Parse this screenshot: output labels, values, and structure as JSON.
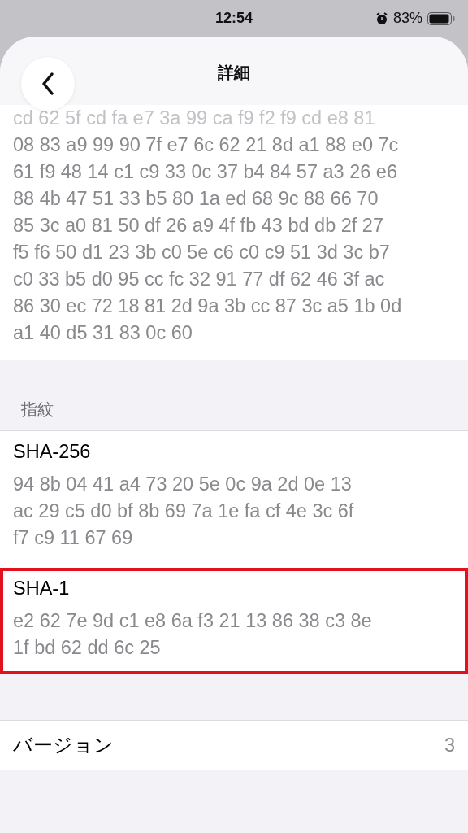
{
  "status_bar": {
    "time": "12:54",
    "battery": "83%"
  },
  "nav": {
    "title": "詳細"
  },
  "key_block": {
    "lines": [
      {
        "text": "cd 62 5f cd fa e7 3a 99 ca f9 f2 f9 cd e8 81",
        "faded": true
      },
      {
        "text": "08 83 a9 99 90 7f e7 6c 62 21 8d a1 88 e0 7c",
        "faded": false
      },
      {
        "text": "61 f9 48 14 c1 c9 33 0c 37 b4 84 57 a3 26 e6",
        "faded": false
      },
      {
        "text": "88 4b 47 51 33 b5 80 1a ed 68 9c 88 66 70",
        "faded": false
      },
      {
        "text": "85 3c a0 81 50 df 26 a9 4f fb 43 bd db 2f 27",
        "faded": false
      },
      {
        "text": "f5 f6 50 d1 23 3b c0 5e c6 c0 c9 51 3d 3c b7",
        "faded": false
      },
      {
        "text": "c0 33 b5 d0 95 cc fc 32 91 77 df 62 46 3f ac",
        "faded": false
      },
      {
        "text": "86 30 ec 72 18 81 2d 9a 3b cc 87 3c a5 1b 0d",
        "faded": false
      },
      {
        "text": "a1 40 d5 31 83 0c 60",
        "faded": false
      }
    ]
  },
  "fingerprints": {
    "header": "指紋",
    "items": [
      {
        "label": "SHA-256",
        "lines": [
          "94 8b 04 41 a4 73 20 5e 0c 9a 2d 0e 13",
          "ac 29 c5 d0 bf 8b 69 7a 1e fa cf 4e 3c 6f",
          "f7 c9 11 67 69"
        ],
        "highlighted": false
      },
      {
        "label": "SHA-1",
        "lines": [
          "e2 62 7e 9d c1 e8 6a f3 21 13 86 38 c3 8e",
          "1f bd 62 dd 6c 25"
        ],
        "highlighted": true
      }
    ]
  },
  "version": {
    "label": "バージョン",
    "value": "3"
  }
}
